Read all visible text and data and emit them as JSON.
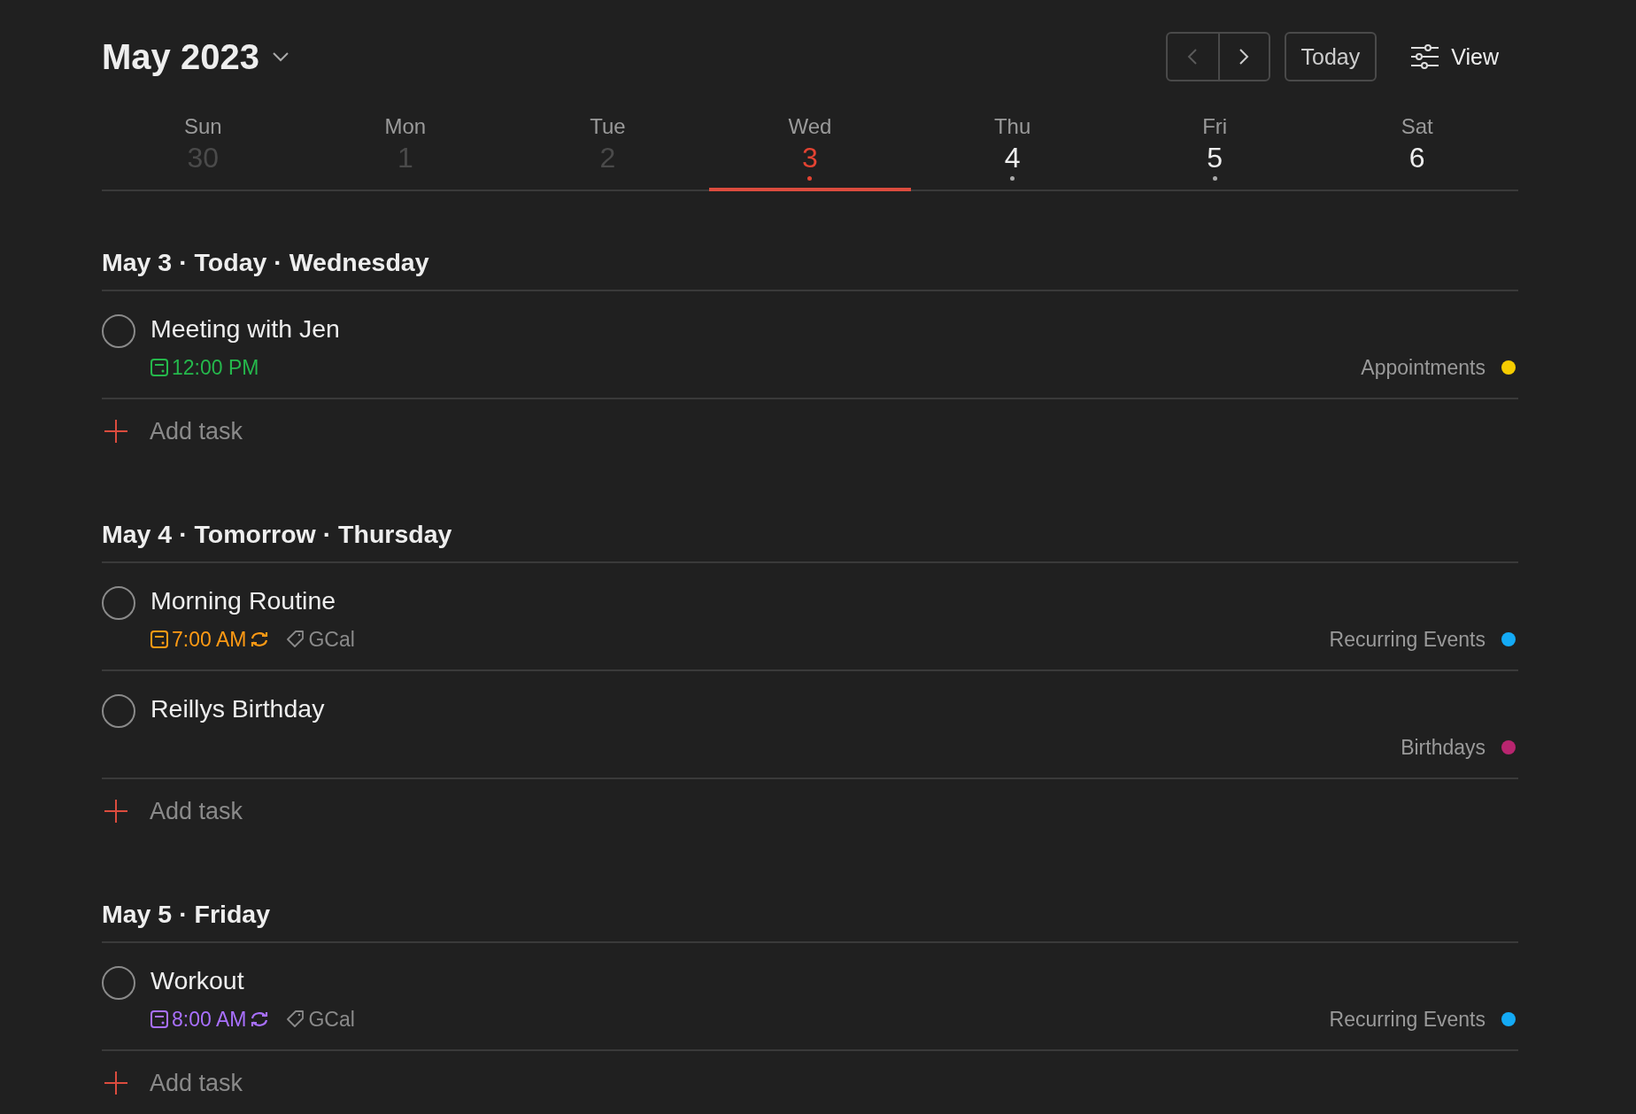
{
  "header": {
    "title": "May 2023",
    "nav": {
      "prev_disabled": true
    },
    "today_button": "Today",
    "view_button": "View"
  },
  "days": [
    {
      "weekday": "Sun",
      "date": "30",
      "selected": false,
      "past": true,
      "has_tasks": false
    },
    {
      "weekday": "Mon",
      "date": "1",
      "selected": false,
      "past": true,
      "has_tasks": false
    },
    {
      "weekday": "Tue",
      "date": "2",
      "selected": false,
      "past": true,
      "has_tasks": false
    },
    {
      "weekday": "Wed",
      "date": "3",
      "selected": true,
      "past": false,
      "has_tasks": true
    },
    {
      "weekday": "Thu",
      "date": "4",
      "selected": false,
      "past": false,
      "has_tasks": true
    },
    {
      "weekday": "Fri",
      "date": "5",
      "selected": false,
      "past": false,
      "has_tasks": true
    },
    {
      "weekday": "Sat",
      "date": "6",
      "selected": false,
      "past": false,
      "has_tasks": false
    }
  ],
  "sections": [
    {
      "heading": "May 3 · Today · Wednesday",
      "add_task": "Add task",
      "tasks": [
        {
          "title": "Meeting with Jen",
          "checked": false,
          "due": {
            "time": "12:00 PM",
            "color": "#25b84c"
          },
          "recurring": false,
          "project": "Appointments",
          "color": "#f5cc00"
        }
      ]
    },
    {
      "heading": "May 4 · Tomorrow · Thursday",
      "add_task": "Add task",
      "tasks": [
        {
          "title": "Morning Routine",
          "checked": false,
          "due": {
            "time": "7:00 AM",
            "color": "#ff9a14"
          },
          "recurring": true,
          "label": "GCal",
          "project": "Recurring Events",
          "color": "#14aaf5"
        },
        {
          "title": "Reillys Birthday",
          "checked": false,
          "project": "Birthdays",
          "color": "#b8256f"
        }
      ]
    },
    {
      "heading": "May 5 · Friday",
      "add_task": "Add task",
      "tasks": [
        {
          "title": "Workout",
          "checked": false,
          "due": {
            "time": "8:00 AM",
            "color": "#a970ff"
          },
          "recurring": true,
          "label": "GCal",
          "project": "Recurring Events",
          "color": "#14aaf5"
        }
      ]
    }
  ]
}
